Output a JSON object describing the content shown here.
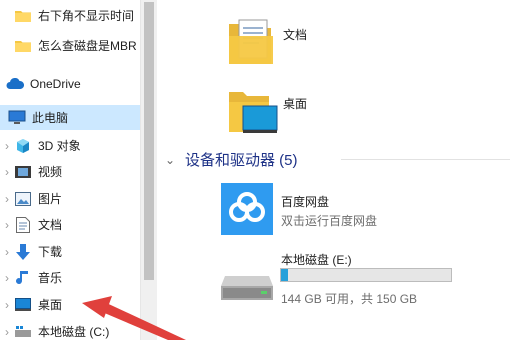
{
  "nav": {
    "items": [
      {
        "label": "右下角不显示时间"
      },
      {
        "label": "怎么查磁盘是MBR"
      },
      {
        "label": "OneDrive"
      },
      {
        "label": "此电脑"
      },
      {
        "label": "3D 对象"
      },
      {
        "label": "视频"
      },
      {
        "label": "图片"
      },
      {
        "label": "文档"
      },
      {
        "label": "下载"
      },
      {
        "label": "音乐"
      },
      {
        "label": "桌面"
      },
      {
        "label": "本地磁盘 (C:)"
      }
    ]
  },
  "folders": [
    {
      "label": "文档"
    },
    {
      "label": "桌面"
    }
  ],
  "section": {
    "title": "设备和驱动器 (5)"
  },
  "devices": [
    {
      "name": "百度网盘",
      "subtitle": "双击运行百度网盘"
    },
    {
      "name": "本地磁盘 (E:)",
      "usage": "144 GB 可用，共 150 GB",
      "used_fraction": 0.04
    }
  ],
  "colors": {
    "selection": "#cce8ff",
    "accent": "#26a0da",
    "arrow": "#e0403c",
    "folder": "#f5c843"
  }
}
